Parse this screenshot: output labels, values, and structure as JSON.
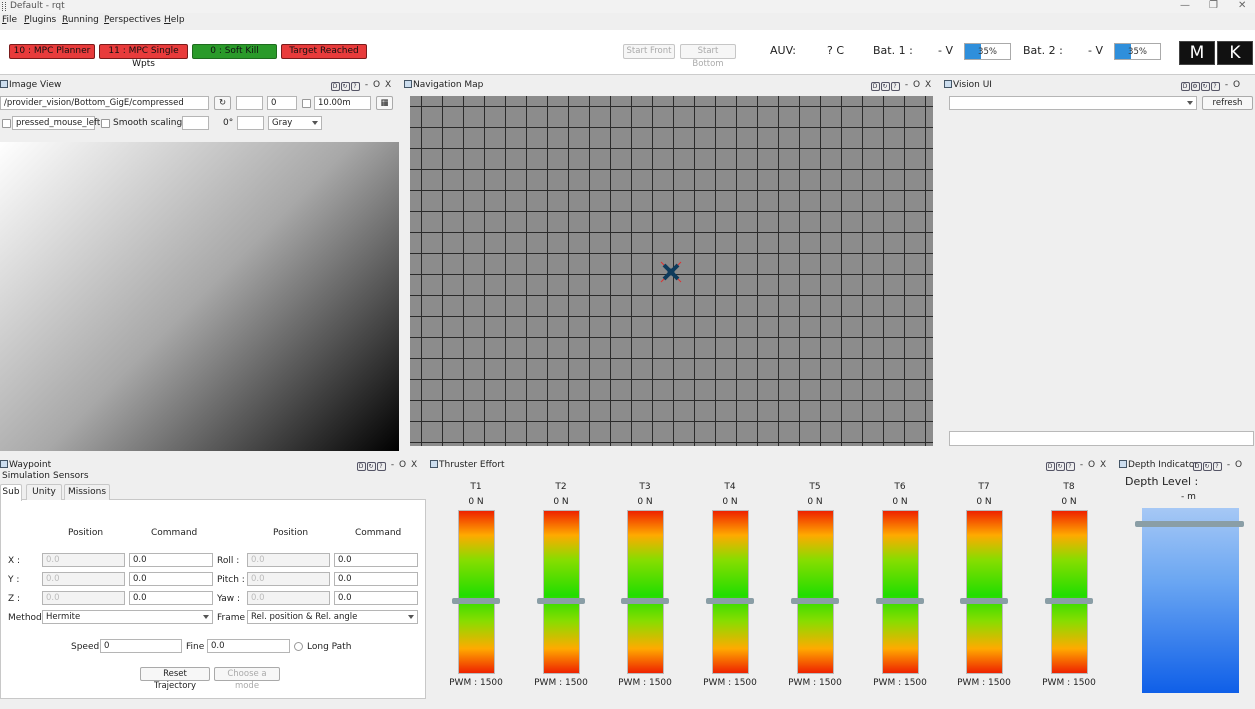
{
  "window": {
    "title": "Default - rqt"
  },
  "menu": [
    "File",
    "Plugins",
    "Running",
    "Perspectives",
    "Help"
  ],
  "toolbar": {
    "modes": [
      {
        "label": "10 : MPC Planner",
        "color": "#e83b3b"
      },
      {
        "label": "11 : MPC Single Wpts",
        "color": "#e83b3b"
      },
      {
        "label": "0 : Soft Kill",
        "color": "#2a9a2a"
      },
      {
        "label": "Target Reached",
        "color": "#e83b3b"
      }
    ],
    "start_front": "Start Front",
    "start_bottom": "Start Bottom",
    "auv_label": "AUV:",
    "auv_temp": "? C",
    "bat1_label": "Bat. 1 :",
    "bat1_voltage": "- V",
    "bat1_percent": "35%",
    "bat1_level": 0.35,
    "bat2_label": "Bat. 2 :",
    "bat2_voltage": "- V",
    "bat2_percent": "35%",
    "bat2_level": 0.35,
    "m_button": "M",
    "k_button": "K"
  },
  "image_view": {
    "title": "Image View",
    "topic": "/provider_vision/Bottom_GigE/compressed",
    "spin_value": "0",
    "range_value": "10.00m",
    "pressed_label": "pressed_mouse_left",
    "smooth_label": "Smooth scaling",
    "rotation": "0°",
    "color_mode": "Gray"
  },
  "navigation_map": {
    "title": "Navigation Map"
  },
  "vision_ui": {
    "title": "Vision UI",
    "refresh": "refresh"
  },
  "waypoint": {
    "title": "Waypoint",
    "menus": [
      "Simulation",
      "Sensors"
    ],
    "tabs": [
      "Sub",
      "Unity",
      "Missions"
    ],
    "headers": [
      "Position",
      "Command",
      "Position",
      "Command"
    ],
    "rows_left": [
      {
        "label": "X :",
        "position": "0.0",
        "command": "0.0"
      },
      {
        "label": "Y :",
        "position": "0.0",
        "command": "0.0"
      },
      {
        "label": "Z :",
        "position": "0.0",
        "command": "0.0"
      }
    ],
    "rows_right": [
      {
        "label": "Roll :",
        "position": "0.0",
        "command": "0.0"
      },
      {
        "label": "Pitch :",
        "position": "0.0",
        "command": "0.0"
      },
      {
        "label": "Yaw :",
        "position": "0.0",
        "command": "0.0"
      }
    ],
    "method_label": "Method",
    "method_value": "Hermite",
    "frame_label": "Frame",
    "frame_value": "Rel. position & Rel. angle",
    "speed_label": "Speed",
    "speed_value": "0",
    "fine_label": "Fine",
    "fine_value": "0.0",
    "long_path": "Long Path",
    "reset": "Reset Trajectory",
    "choose_mode": "Choose a mode"
  },
  "thruster_effort": {
    "title": "Thruster Effort",
    "thrusters": [
      {
        "name": "T1",
        "force": "0 N",
        "pwm": "PWM : 1500"
      },
      {
        "name": "T2",
        "force": "0 N",
        "pwm": "PWM : 1500"
      },
      {
        "name": "T3",
        "force": "0 N",
        "pwm": "PWM : 1500"
      },
      {
        "name": "T4",
        "force": "0 N",
        "pwm": "PWM : 1500"
      },
      {
        "name": "T5",
        "force": "0 N",
        "pwm": "PWM : 1500"
      },
      {
        "name": "T6",
        "force": "0 N",
        "pwm": "PWM : 1500"
      },
      {
        "name": "T7",
        "force": "0 N",
        "pwm": "PWM : 1500"
      },
      {
        "name": "T8",
        "force": "0 N",
        "pwm": "PWM : 1500"
      }
    ]
  },
  "depth_indicator": {
    "title": "Depth Indicator",
    "label": "Depth Level :",
    "value": "- m"
  },
  "panel_controls": {
    "d": "D",
    "dash": "-",
    "o": "O",
    "x": "X"
  }
}
